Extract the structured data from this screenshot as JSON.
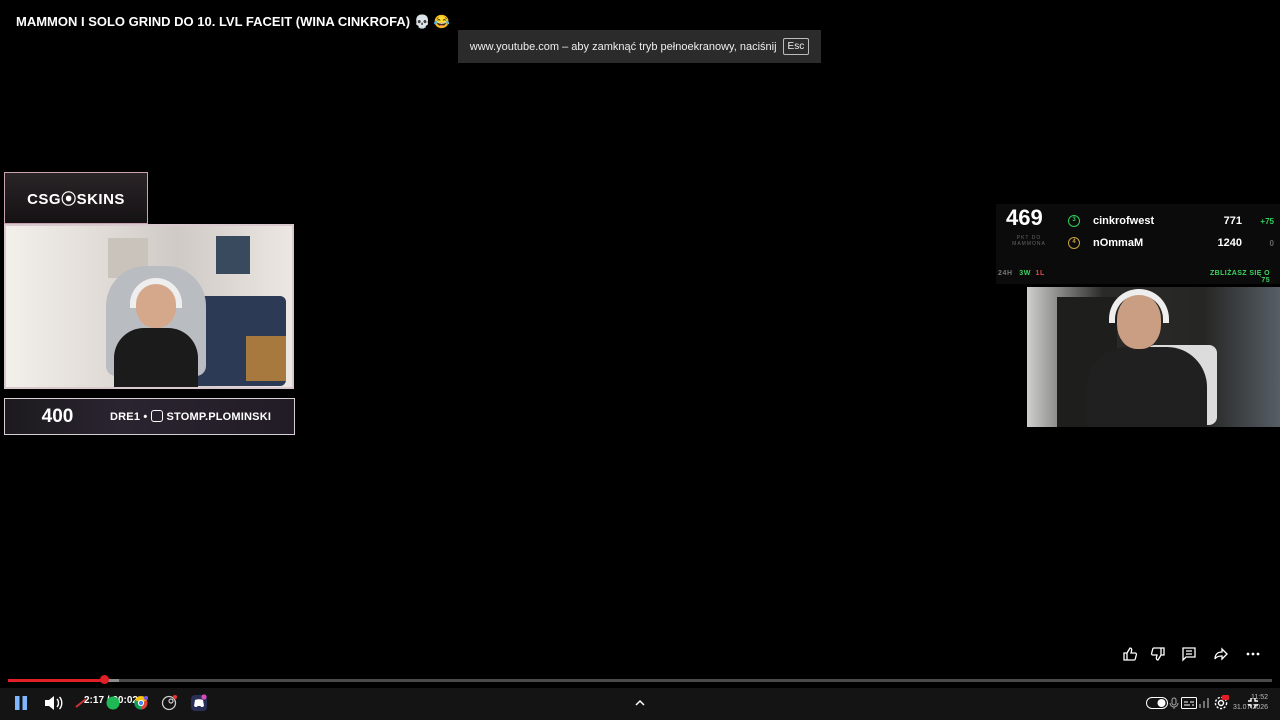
{
  "video": {
    "title": "MAMMON I SOLO GRIND DO 10. LVL FACEIT (WINA CINKROFA)",
    "title_emoji": "💀 😂"
  },
  "fullscreen_notice": {
    "text": "www.youtube.com – aby zamknąć tryb pełnoekranowy, naciśnij",
    "key": "Esc"
  },
  "stream_left": {
    "sponsor_logo": "CSG⦿SKINS",
    "counter": "400",
    "social_text_prefix": "DRE1  •",
    "social_handle": "STOMP.PLOMINSKI"
  },
  "stream_right": {
    "score": "469",
    "score_caption": "PKT DO MAMMONA",
    "players": [
      {
        "name": "cinkrofwest",
        "level": "3",
        "points": "771",
        "delta": "+75",
        "color": "#2fd05a"
      },
      {
        "name": "nOmmaM",
        "level": "4",
        "points": "1240",
        "delta": "0",
        "color": "#c9a13b"
      }
    ],
    "record": {
      "period": "24H",
      "wins": "3W",
      "losses": "1L"
    },
    "footer_right": "ZBLIŻASZ SIĘ O 75"
  },
  "progress": {
    "played_fraction": 0.076,
    "buffered_fraction": 0.088
  },
  "player_controls": {
    "time_current": "2:17",
    "time_total": "30:02",
    "time_separator": " / "
  },
  "tray": {
    "time": "11:52",
    "date": "31.07.2026"
  },
  "colors": {
    "accent_red": "#e01f26",
    "overlay_green": "#3fd461"
  }
}
